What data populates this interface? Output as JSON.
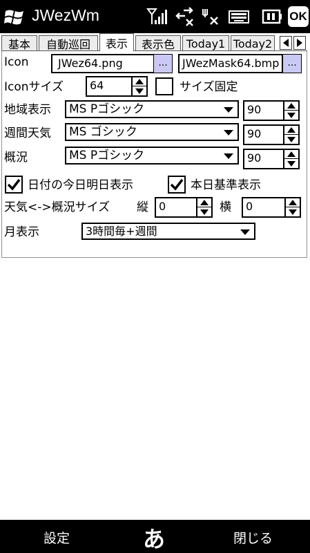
{
  "title_bar": {
    "app_title": "JWezWm",
    "ok_label": "OK"
  },
  "tabs": [
    {
      "label": "基本",
      "active": false
    },
    {
      "label": "自動巡回",
      "active": false
    },
    {
      "label": "表示",
      "active": true
    },
    {
      "label": "表示色",
      "active": false
    },
    {
      "label": "Today1",
      "active": false
    },
    {
      "label": "Today2",
      "active": false
    }
  ],
  "icon_row": {
    "label": "Icon",
    "icon_file": "JWez64.png",
    "mask_file": "JWezMask64.bmp",
    "browse_label": "..."
  },
  "icon_size_row": {
    "label": "Iconサイズ",
    "value": "64",
    "fixed_label": "サイズ固定",
    "fixed_checked": false
  },
  "font_rows": [
    {
      "label": "地域表示",
      "font": "MS Pゴシック",
      "size": "90"
    },
    {
      "label": "週間天気",
      "font": "MS ゴシック",
      "size": "90"
    },
    {
      "label": "概況",
      "font": "MS Pゴシック",
      "size": "90"
    }
  ],
  "options": {
    "today_tomorrow_label": "日付の今日明日表示",
    "today_tomorrow_checked": true,
    "base_today_label": "本日基準表示",
    "base_today_checked": true
  },
  "size_row": {
    "label": "天気<->概況サイズ",
    "vertical_label": "縦",
    "vertical_value": "0",
    "horizontal_label": "横",
    "horizontal_value": "0"
  },
  "month_row": {
    "label": "月表示",
    "value": "3時間毎+週間"
  },
  "bottom_bar": {
    "left_softkey": "設定",
    "ime_label": "あ",
    "right_softkey": "閉じる"
  }
}
